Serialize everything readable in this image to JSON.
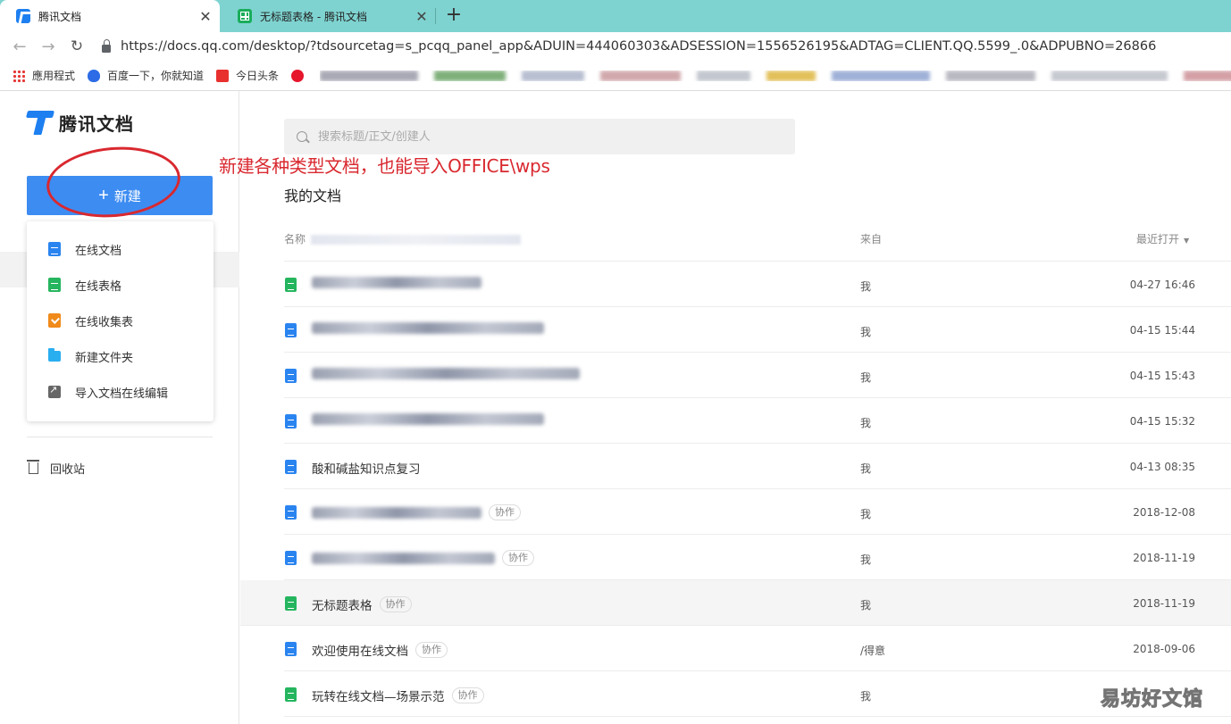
{
  "browser": {
    "tabs": [
      {
        "label": "腾讯文档",
        "icon": "tencent-docs-icon",
        "active": true
      },
      {
        "label": "无标题表格 - 腾讯文档",
        "icon": "sheet-icon",
        "active": false
      }
    ],
    "new_tab": "+",
    "close": "✕",
    "url": "https://docs.qq.com/desktop/?tdsourcetag=s_pcqq_panel_app&ADUIN=444060303&ADSESSION=1556526195&ADTAG=CLIENT.QQ.5599_.0&ADPUBNO=26866",
    "bookmarks": [
      {
        "label": "應用程式",
        "icon": "apps-icon"
      },
      {
        "label": "百度一下，你就知道",
        "icon": "baidu-icon"
      },
      {
        "label": "今日头条",
        "icon": "toutiao-icon"
      }
    ]
  },
  "sidebar": {
    "logo_text": "腾讯文档",
    "new_button": {
      "plus": "+",
      "label": "新建"
    },
    "new_menu": [
      {
        "label": "在线文档",
        "icon": "doc-icon"
      },
      {
        "label": "在线表格",
        "icon": "sheet-icon"
      },
      {
        "label": "在线收集表",
        "icon": "form-icon"
      },
      {
        "label": "新建文件夹",
        "icon": "folder-icon"
      },
      {
        "label": "导入文档在线编辑",
        "icon": "import-icon"
      }
    ],
    "trash": "回收站"
  },
  "annotation": {
    "text": "新建各种类型文档，也能导入OFFICE\\wps",
    "color": "#d9282f"
  },
  "main": {
    "search_placeholder": "搜索标题/正文/创建人",
    "section_title": "我的文档",
    "columns": {
      "name": "名称",
      "from": "来自",
      "opened": "最近打开",
      "sort_caret": "▼"
    },
    "rows": [
      {
        "type": "sheet",
        "name": "",
        "blurred": true,
        "tag": "",
        "from": "我",
        "date": "04-27 16:46"
      },
      {
        "type": "doc",
        "name": "",
        "blurred": true,
        "tag": "",
        "from": "我",
        "date": "04-15 15:44"
      },
      {
        "type": "doc",
        "name": "",
        "blurred": true,
        "tag": "",
        "from": "我",
        "date": "04-15 15:43"
      },
      {
        "type": "doc",
        "name": "",
        "blurred": true,
        "tag": "",
        "from": "我",
        "date": "04-15 15:32"
      },
      {
        "type": "doc",
        "name": "酸和碱盐知识点复习",
        "blurred": false,
        "tag": "",
        "from": "我",
        "date": "04-13 08:35"
      },
      {
        "type": "doc",
        "name": "",
        "blurred": true,
        "tag": "协作",
        "from": "我",
        "date": "2018-12-08"
      },
      {
        "type": "doc",
        "name": "",
        "blurred": true,
        "tag": "协作",
        "from": "我",
        "date": "2018-11-19"
      },
      {
        "type": "sheet",
        "name": "无标题表格",
        "blurred": false,
        "tag": "协作",
        "from": "我",
        "date": "2018-11-19",
        "highlighted": true
      },
      {
        "type": "welcome",
        "name": "欢迎使用在线文档",
        "blurred": false,
        "tag": "协作",
        "from": "/得意",
        "date": "2018-09-06"
      },
      {
        "type": "sheet",
        "name": "玩转在线文档—场景示范",
        "blurred": false,
        "tag": "协作",
        "from": "我",
        "date": ""
      }
    ]
  },
  "watermark": "易坊好文馆"
}
